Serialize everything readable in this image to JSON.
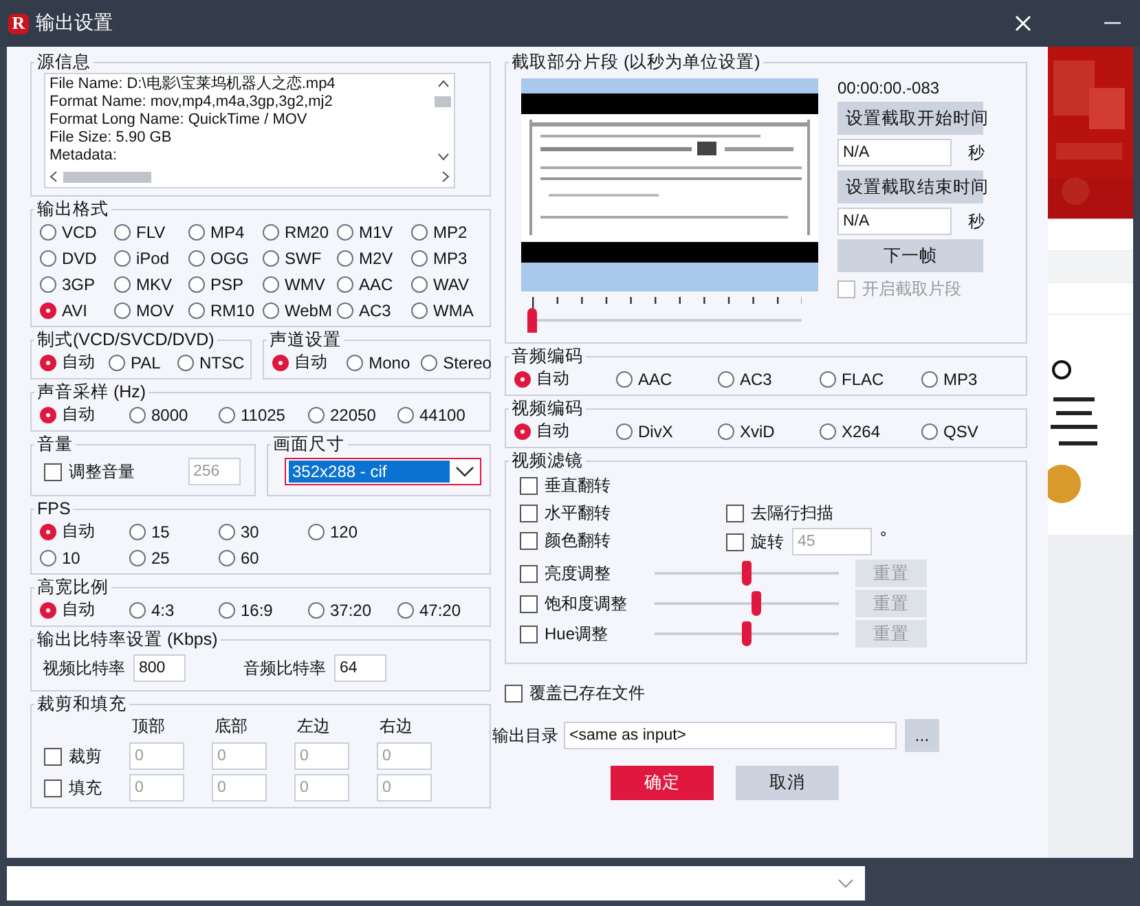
{
  "window": {
    "title": "输出设置",
    "icon_letter": "R"
  },
  "source_info": {
    "title": "源信息",
    "lines": [
      "File Name: D:\\电影\\宝莱坞机器人之恋.mp4",
      "Format Name: mov,mp4,m4a,3gp,3g2,mj2",
      "Format Long Name: QuickTime / MOV",
      "File Size: 5.90 GB",
      "Metadata:"
    ]
  },
  "output_format": {
    "title": "输出格式",
    "options": [
      {
        "label": "VCD",
        "selected": false
      },
      {
        "label": "FLV",
        "selected": false
      },
      {
        "label": "MP4",
        "selected": false
      },
      {
        "label": "RM20",
        "selected": false
      },
      {
        "label": "M1V",
        "selected": false
      },
      {
        "label": "MP2",
        "selected": false
      },
      {
        "label": "DVD",
        "selected": false
      },
      {
        "label": "iPod",
        "selected": false
      },
      {
        "label": "OGG",
        "selected": false
      },
      {
        "label": "SWF",
        "selected": false
      },
      {
        "label": "M2V",
        "selected": false
      },
      {
        "label": "MP3",
        "selected": false
      },
      {
        "label": "3GP",
        "selected": false
      },
      {
        "label": "MKV",
        "selected": false
      },
      {
        "label": "PSP",
        "selected": false
      },
      {
        "label": "WMV",
        "selected": false
      },
      {
        "label": "AAC",
        "selected": false
      },
      {
        "label": "WAV",
        "selected": false
      },
      {
        "label": "AVI",
        "selected": true
      },
      {
        "label": "MOV",
        "selected": false
      },
      {
        "label": "RM10",
        "selected": false
      },
      {
        "label": "WebM",
        "selected": false
      },
      {
        "label": "AC3",
        "selected": false
      },
      {
        "label": "WMA",
        "selected": false
      }
    ]
  },
  "standard": {
    "title": "制式(VCD/SVCD/DVD)",
    "options": [
      {
        "label": "自动",
        "selected": true
      },
      {
        "label": "PAL",
        "selected": false
      },
      {
        "label": "NTSC",
        "selected": false
      }
    ]
  },
  "channels": {
    "title": "声道设置",
    "options": [
      {
        "label": "自动",
        "selected": true
      },
      {
        "label": "Mono",
        "selected": false
      },
      {
        "label": "Stereo",
        "selected": false
      }
    ]
  },
  "sample_rate": {
    "title": "声音采样 (Hz)",
    "options": [
      {
        "label": "自动",
        "selected": true
      },
      {
        "label": "8000",
        "selected": false
      },
      {
        "label": "11025",
        "selected": false
      },
      {
        "label": "22050",
        "selected": false
      },
      {
        "label": "44100",
        "selected": false
      }
    ]
  },
  "volume": {
    "title": "音量",
    "checkbox": {
      "label": "调整音量",
      "checked": false
    },
    "value": "256"
  },
  "frame_size": {
    "title": "画面尺寸",
    "value": "352x288 - cif"
  },
  "fps": {
    "title": "FPS",
    "options": [
      {
        "label": "自动",
        "selected": true
      },
      {
        "label": "15",
        "selected": false
      },
      {
        "label": "30",
        "selected": false
      },
      {
        "label": "120",
        "selected": false
      },
      {
        "label": "10",
        "selected": false
      },
      {
        "label": "25",
        "selected": false
      },
      {
        "label": "60",
        "selected": false
      }
    ]
  },
  "aspect": {
    "title": "高宽比例",
    "options": [
      {
        "label": "自动",
        "selected": true
      },
      {
        "label": "4:3",
        "selected": false
      },
      {
        "label": "16:9",
        "selected": false
      },
      {
        "label": "37:20",
        "selected": false
      },
      {
        "label": "47:20",
        "selected": false
      }
    ]
  },
  "bitrate": {
    "title": "输出比特率设置 (Kbps)",
    "video_label": "视频比特率",
    "video_value": "800",
    "audio_label": "音频比特率",
    "audio_value": "64"
  },
  "crop_pad": {
    "title": "裁剪和填充",
    "columns": [
      "顶部",
      "底部",
      "左边",
      "右边"
    ],
    "rows": [
      {
        "label": "裁剪",
        "checked": false,
        "values": [
          "0",
          "0",
          "0",
          "0"
        ]
      },
      {
        "label": "填充",
        "checked": false,
        "values": [
          "0",
          "0",
          "0",
          "0"
        ]
      }
    ]
  },
  "clip": {
    "title": "截取部分片段 (以秒为单位设置)",
    "time": "00:00:00.-083",
    "start_button": "设置截取开始时间",
    "start_value": "N/A",
    "start_unit": "秒",
    "end_button": "设置截取结束时间",
    "end_value": "N/A",
    "end_unit": "秒",
    "next_button": "下一帧",
    "enable": {
      "label": "开启截取片段",
      "checked": false,
      "disabled": true
    },
    "position": {
      "level": 0
    }
  },
  "audio_codec": {
    "title": "音频编码",
    "options": [
      {
        "label": "自动",
        "selected": true
      },
      {
        "label": "AAC",
        "selected": false
      },
      {
        "label": "AC3",
        "selected": false
      },
      {
        "label": "FLAC",
        "selected": false
      },
      {
        "label": "MP3",
        "selected": false
      }
    ]
  },
  "video_codec": {
    "title": "视频编码",
    "options": [
      {
        "label": "自动",
        "selected": true
      },
      {
        "label": "DivX",
        "selected": false
      },
      {
        "label": "XviD",
        "selected": false
      },
      {
        "label": "X264",
        "selected": false
      },
      {
        "label": "QSV",
        "selected": false
      }
    ]
  },
  "video_filters": {
    "title": "视频滤镜",
    "flips": [
      {
        "label": "垂直翻转",
        "checked": false
      },
      {
        "label": "水平翻转",
        "checked": false
      },
      {
        "label": "颜色翻转",
        "checked": false
      }
    ],
    "deinterlace": {
      "label": "去隔行扫描",
      "checked": false
    },
    "rotate": {
      "label": "旋转",
      "checked": false,
      "value": "45",
      "unit": "°"
    },
    "adjustments": [
      {
        "label": "亮度调整",
        "checked": false,
        "level": 0.5,
        "reset": "重置",
        "disabled": true
      },
      {
        "label": "饱和度调整",
        "checked": false,
        "level": 0.55,
        "reset": "重置",
        "disabled": true
      },
      {
        "label": "Hue调整",
        "checked": false,
        "level": 0.5,
        "reset": "重置",
        "disabled": true
      }
    ]
  },
  "overwrite": {
    "label": "覆盖已存在文件",
    "checked": false
  },
  "output_dir": {
    "label": "输出目录",
    "value": "<same as input>",
    "browse": "..."
  },
  "buttons": [
    {
      "label": "确定",
      "kind": "primary"
    },
    {
      "label": "取消",
      "kind": "secondary"
    }
  ]
}
